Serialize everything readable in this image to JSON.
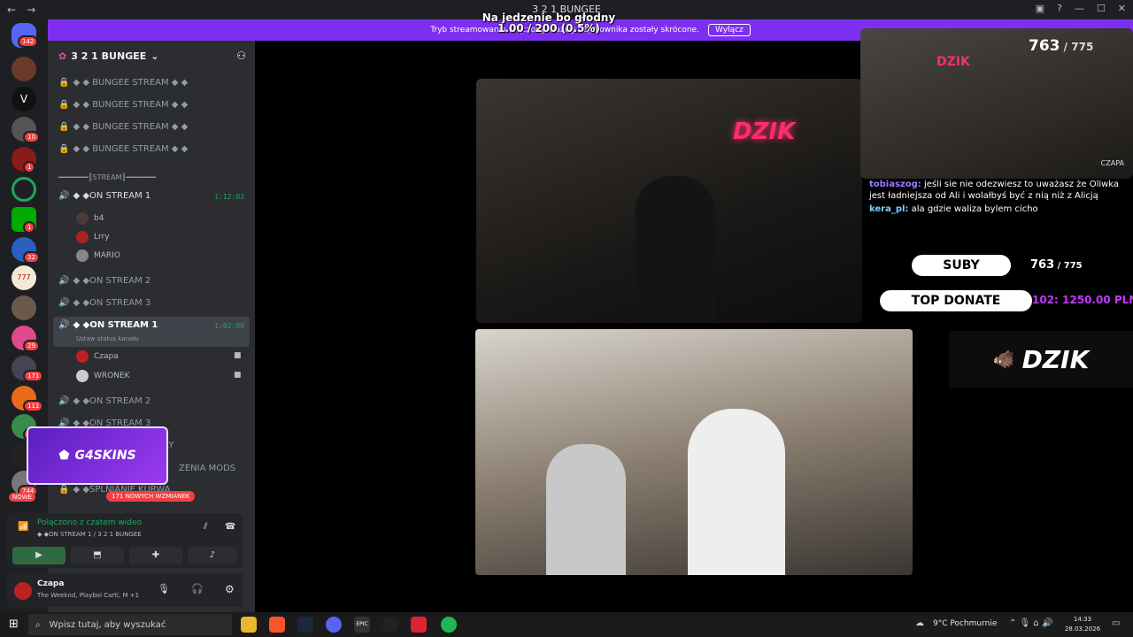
{
  "window": {
    "title": "3 2 1 BUNGEE"
  },
  "overlay": {
    "line1": "Na jedzenie bo głodny",
    "line2": "1.00 / 200 (0.5%)"
  },
  "banner": {
    "text": "Tryb streamowania włączony. Nazwy użytkownika zostały skrócone.",
    "button": "Wyłącz"
  },
  "rail": {
    "dm_badge": "142",
    "letter": "V",
    "badges": [
      "10",
      "1",
      "1",
      "32",
      "29",
      "171",
      "111",
      "146",
      "744"
    ],
    "new_label": "NOWE"
  },
  "server": {
    "name": "3 2 1 BUNGEE"
  },
  "channels": {
    "locked": [
      "◆ ◆ BUNGEE STREAM ◆ ◆",
      "◆ ◆ BUNGEE STREAM ◆ ◆",
      "◆ ◆ BUNGEE STREAM ◆ ◆",
      "◆ ◆ BUNGEE STREAM ◆ ◆"
    ],
    "category": "━━━━━━━║STREAM║━━━━━━━",
    "voice1": {
      "name": "◆ ◆ON STREAM 1",
      "time": "1:12:03",
      "users": [
        "b4",
        "Lrry",
        "MARIO"
      ]
    },
    "voice2": "◆ ◆ON STREAM 2",
    "voice3": "◆ ◆ON STREAM 3",
    "active": {
      "name": "◆ ◆ON STREAM 1",
      "time": "1:02:00",
      "status": "Ustaw status kanału",
      "users": [
        "Czapa",
        "WRONEK"
      ]
    },
    "voice4": "◆ ◆ON STREAM 2",
    "voice5": "◆ ◆ON STREAM 3",
    "partial1": "RY",
    "partial2": "ZENIA MODS",
    "partial3": "◆ ◆SPLNIANIE KURWA"
  },
  "mentions": "171 NOWYCH WZMIANEK",
  "promo": {
    "logo": "G4SKINS"
  },
  "voice": {
    "status": "Połączono z czatem wideo",
    "channel": "◆ ◆ON STREAM 1 / 3 2 1 BUNGEE"
  },
  "user": {
    "name": "Czapa",
    "activity": "The Weeknd, Playboi Carti, M +1"
  },
  "streams": {
    "top_right_tag": "CZAPA",
    "counter": "763",
    "counter_total": "775",
    "chat": [
      {
        "user": "tobiaszog:",
        "text": "jeśli sie nie odezwiesz to uważasz że Oliwka jest ładniejsza od Ali i wolałbyś być z nią niż z Alicją"
      },
      {
        "user": "kera_pl:",
        "text": "ala gdzie waliza bylem cicho"
      }
    ],
    "suby_label": "SUBY",
    "suby_value": "763",
    "suby_total": "775",
    "donate_label": "TOP DONATE",
    "donate_value": "102: 1250.00 PLN 4.",
    "brand": "DZIK",
    "neon": "DZIK",
    "mini_logo": "DZIK"
  },
  "taskbar": {
    "search_placeholder": "Wpisz tutaj, aby wyszukać",
    "weather": "9°C  Pochmurnie",
    "time": "14:33",
    "date": "28.03.2026"
  },
  "colors": {
    "accent": "#7d2ff0",
    "online": "#23a55a",
    "danger": "#f23f43"
  }
}
